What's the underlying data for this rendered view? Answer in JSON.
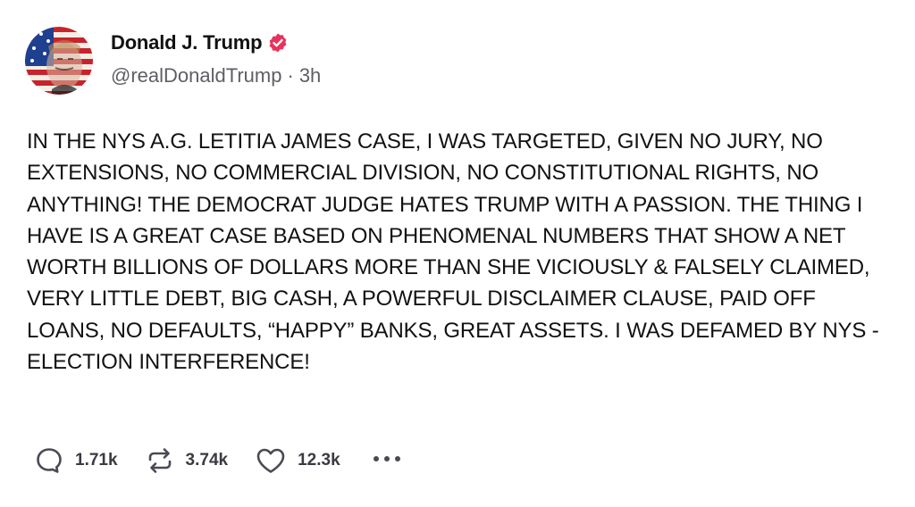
{
  "author": {
    "display_name": "Donald J. Trump",
    "handle": "@realDonaldTrump",
    "separator": "·",
    "time": "3h",
    "verified": true,
    "verified_color": "#e8335b"
  },
  "post": {
    "text": "IN THE NYS A.G. LETITIA JAMES CASE, I WAS TARGETED, GIVEN NO JURY, NO EXTENSIONS, NO COMMERCIAL DIVISION, NO CONSTITUTIONAL RIGHTS, NO ANYTHING! THE DEMOCRAT JUDGE HATES TRUMP WITH A PASSION. THE THING I HAVE IS A GREAT CASE BASED ON PHENOMENAL NUMBERS THAT SHOW A NET WORTH BILLIONS OF DOLLARS MORE THAN SHE VICIOUSLY & FALSELY CLAIMED, VERY LITTLE DEBT, BIG CASH, A POWERFUL DISCLAIMER CLAUSE, PAID OFF LOANS, NO DEFAULTS, “HAPPY” BANKS, GREAT ASSETS. I WAS DEFAMED BY NYS - ELECTION INTERFERENCE!"
  },
  "actions": {
    "replies": {
      "icon": "reply-bubble-icon",
      "count": "1.71k"
    },
    "retruths": {
      "icon": "repost-icon",
      "count": "3.74k"
    },
    "likes": {
      "icon": "heart-icon",
      "count": "12.3k"
    },
    "more": {
      "icon": "more-dots-icon"
    }
  },
  "colors": {
    "text": "#121212",
    "muted": "#5e5e66",
    "icon": "#4a4a55",
    "accent": "#e8335b"
  }
}
